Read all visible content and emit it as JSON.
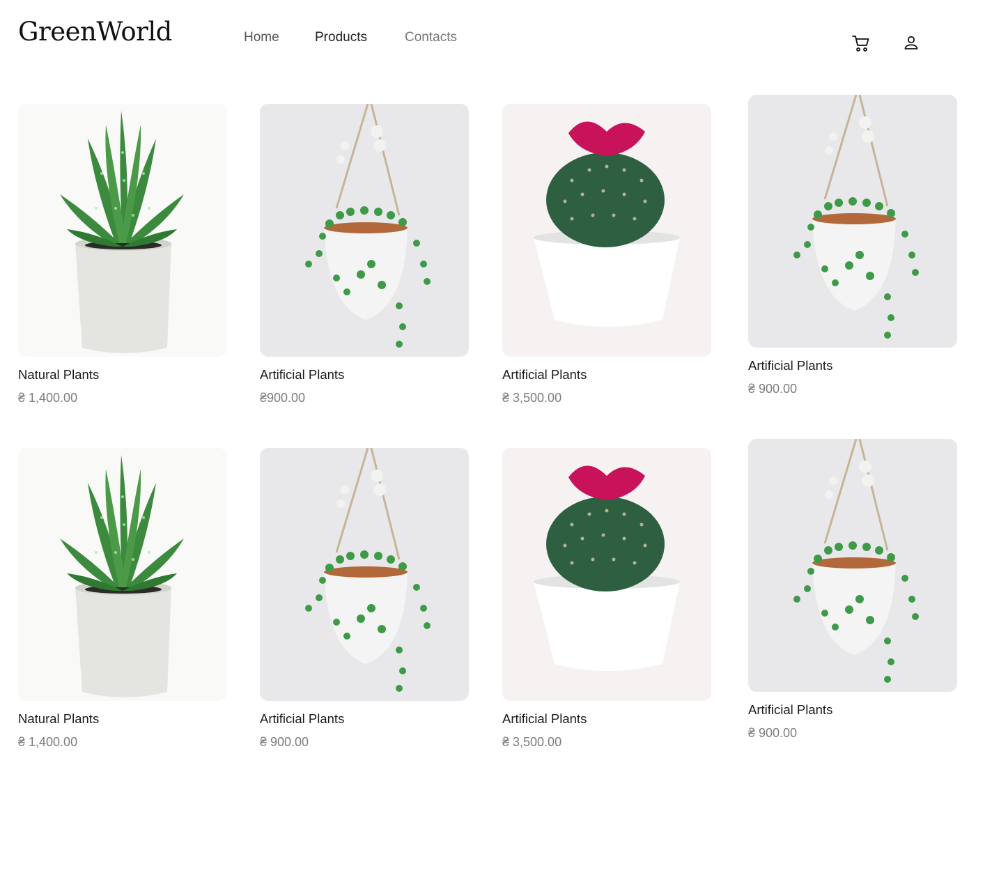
{
  "header": {
    "logo": "GreenWorld",
    "nav": [
      {
        "label": "Home"
      },
      {
        "label": "Products"
      },
      {
        "label": "Contacts"
      }
    ],
    "icons": [
      "cart-icon",
      "user-icon"
    ]
  },
  "products": [
    {
      "name": "Natural Plants",
      "price": "₴ 1,400.00",
      "image": "aloe-plant-image"
    },
    {
      "name": "Artificial Plants",
      "price": "₴900.00",
      "image": "hanging-plant-image"
    },
    {
      "name": "Artificial Plants",
      "price": "₴  3,500.00",
      "image": "cactus-plant-image"
    },
    {
      "name": "Artificial Plants",
      "price": "₴  900.00",
      "image": "hanging-plant-image"
    },
    {
      "name": "Natural Plants",
      "price": "₴ 1,400.00",
      "image": "aloe-plant-image"
    },
    {
      "name": "Artificial Plants",
      "price": "₴ 900.00",
      "image": "hanging-plant-image"
    },
    {
      "name": "Artificial Plants",
      "price": "₴ 3,500.00",
      "image": "cactus-plant-image"
    },
    {
      "name": "Artificial Plants",
      "price": "₴  900.00",
      "image": "hanging-plant-image"
    }
  ],
  "colors": {
    "leaf": "#3c8a3e",
    "flower": "#c8135a",
    "background": "#ffffff"
  }
}
